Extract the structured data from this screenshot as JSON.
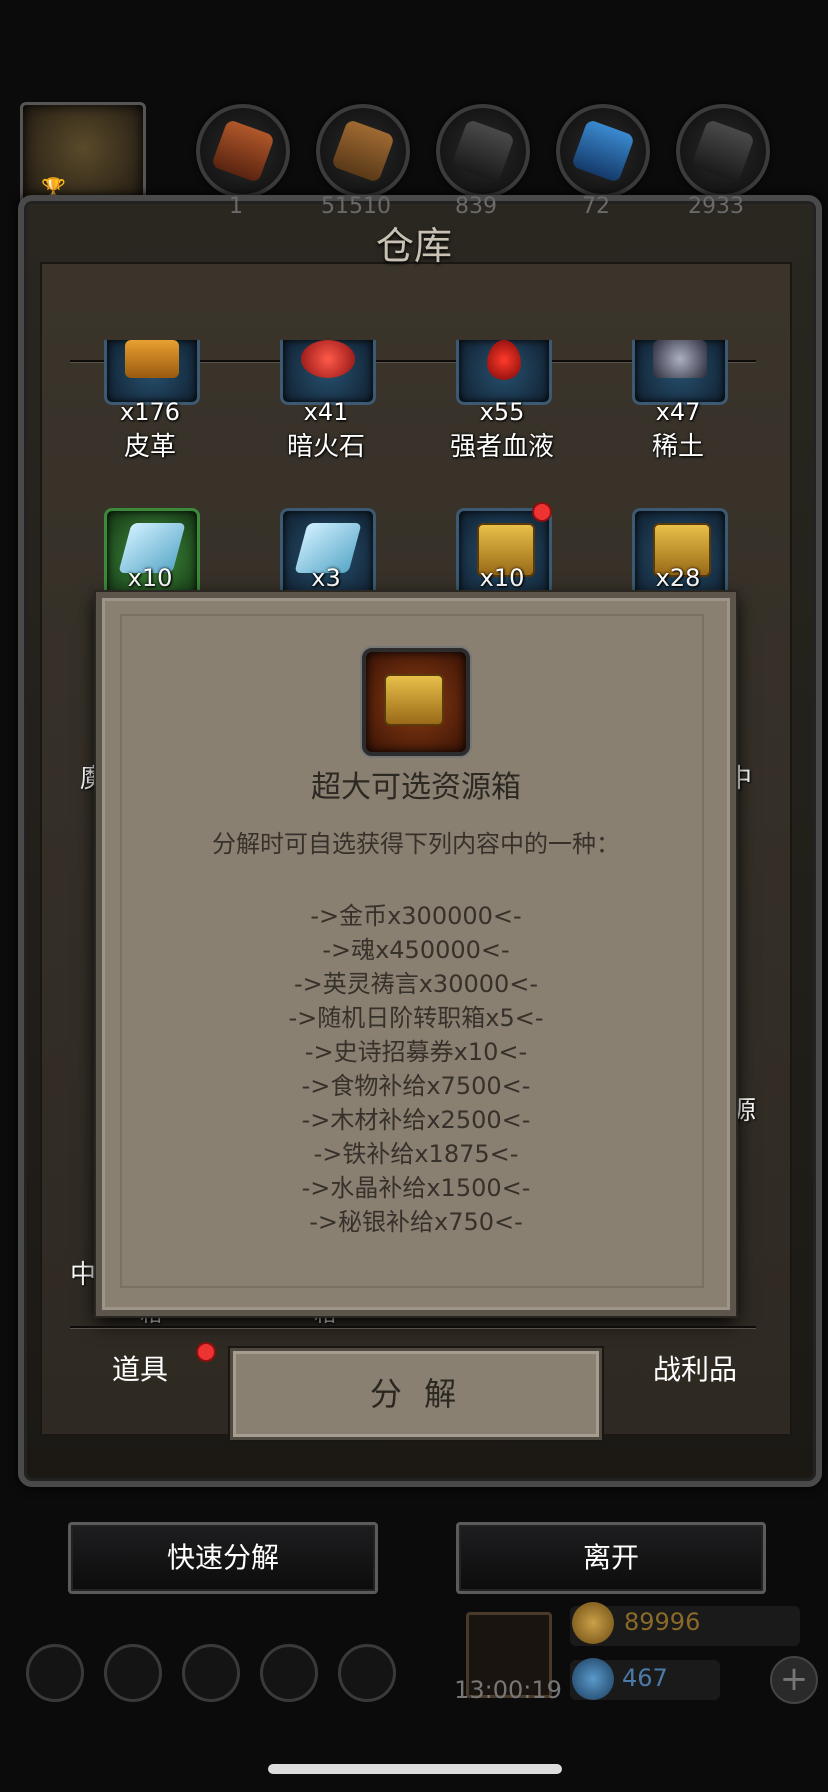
{
  "colors": {
    "accent_red": "#e33333",
    "gold": "#d8b24a",
    "popup_bg": "#8a8072"
  },
  "top_bar": {
    "resources": [
      {
        "icon": "leather-icon",
        "count": "1"
      },
      {
        "icon": "wood-icon",
        "count": "51510"
      },
      {
        "icon": "iron-icon",
        "count": "839"
      },
      {
        "icon": "crystal-icon",
        "count": "72"
      },
      {
        "icon": "mithril-icon",
        "count": "2933"
      }
    ]
  },
  "window": {
    "title": "仓库"
  },
  "items_row1": [
    {
      "icon": "leather-icon",
      "count": "x176",
      "name": "皮革"
    },
    {
      "icon": "dark-fire-stone-icon",
      "count": "x41",
      "name": "暗火石"
    },
    {
      "icon": "blood-drop-icon",
      "count": "x55",
      "name": "强者血液"
    },
    {
      "icon": "rare-earth-icon",
      "count": "x47",
      "name": "稀土"
    }
  ],
  "items_row2": [
    {
      "icon": "ingot-icon",
      "count": "x10"
    },
    {
      "icon": "ingot-icon",
      "count": "x3"
    },
    {
      "icon": "chest-icon",
      "count": "x10"
    },
    {
      "icon": "chest-icon",
      "count": "x28"
    }
  ],
  "side_fragments": {
    "left1": "魔",
    "right1": "中",
    "right2": "源",
    "left3": "中",
    "bottom1": "箱",
    "bottom2": "箱"
  },
  "popup": {
    "title": "超大可选资源箱",
    "description": "分解时可自选获得下列内容中的一种：",
    "options": [
      "->金币x300000<-",
      "->魂x450000<-",
      "->英灵祷言x30000<-",
      "->随机日阶转职箱x5<-",
      "->史诗招募券x10<-",
      "->食物补给x7500<-",
      "->木材补给x2500<-",
      "->铁补给x1875<-",
      "->水晶补给x1500<-",
      "->秘银补给x750<-"
    ]
  },
  "tabs": {
    "items": "道具",
    "trophies": "战利品"
  },
  "decompose_button": "分 解",
  "actions": {
    "quick_decompose": "快速分解",
    "leave": "离开"
  },
  "hud": {
    "timer": "13:00:19",
    "gold": "89996",
    "gems": "467",
    "plus": "+"
  }
}
